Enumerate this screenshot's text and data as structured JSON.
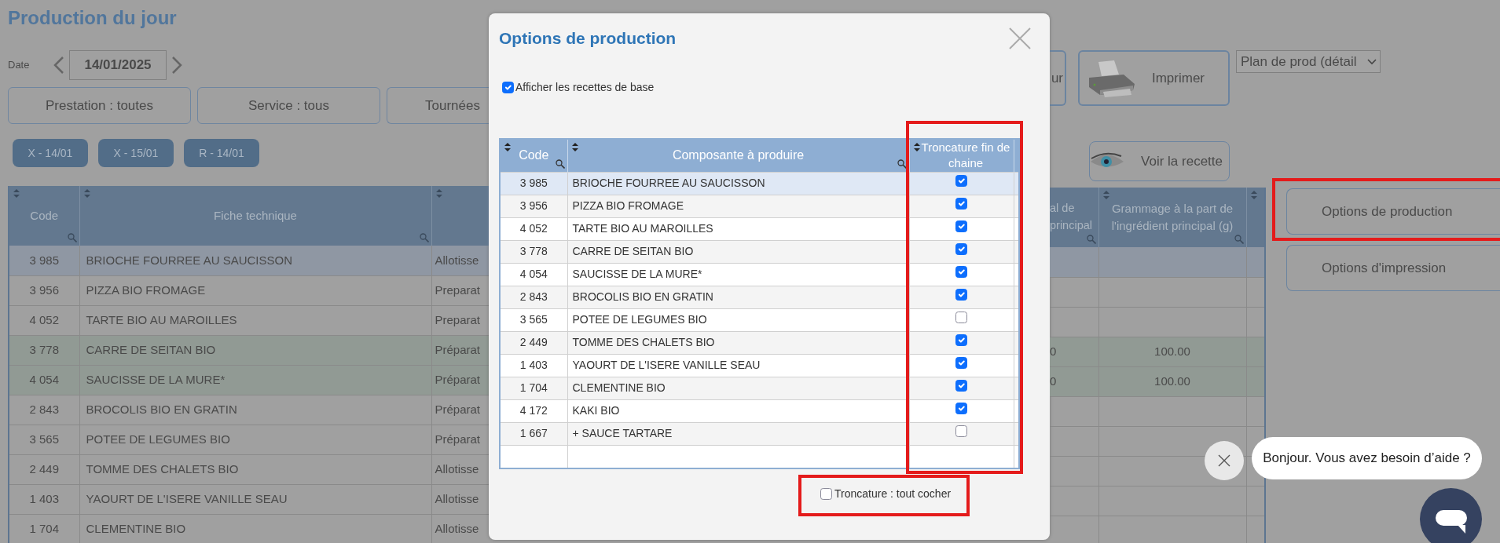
{
  "page": {
    "title": "Production du jour",
    "date_label": "Date",
    "date": "14/01/2025",
    "filters": [
      "Prestation : toutes",
      "Service : tous",
      "Tournées"
    ],
    "chips": [
      "X - 14/01",
      "X - 15/01",
      "R - 14/01"
    ],
    "partial_button": "ur",
    "print_button": "Imprimer",
    "report_select": "Plan de prod (détail",
    "view_recipe_button": "Voir la recette",
    "side_buttons": [
      {
        "label": "Options de production",
        "annotated": true
      },
      {
        "label": "Options d'impression",
        "annotated": false
      }
    ]
  },
  "main_table": {
    "columns": [
      "Code",
      "Fiche technique"
    ],
    "right_columns": [
      "al de principal",
      "Grammage à la part de l'ingrédient principal (g)"
    ],
    "rows": [
      {
        "code": "3 985",
        "name": "BRIOCHE FOURREE AU SAUCISSON",
        "column_3": "Allotisse",
        "selected": true,
        "highlighted": false
      },
      {
        "code": "3 956",
        "name": "PIZZA BIO FROMAGE",
        "column_3": "Preparat",
        "selected": false,
        "highlighted": false
      },
      {
        "code": "4 052",
        "name": "TARTE BIO AU MAROILLES",
        "column_3": "Preparat",
        "selected": false,
        "highlighted": false
      },
      {
        "code": "3 778",
        "name": "CARRE DE SEITAN BIO",
        "column_3": "Préparat",
        "principal": "0",
        "grammage": "100.00",
        "selected": false,
        "highlighted": true
      },
      {
        "code": "4 054",
        "name": "SAUCISSE DE LA MURE*",
        "column_3": "Préparat",
        "principal": "0",
        "grammage": "100.00",
        "selected": false,
        "highlighted": true
      },
      {
        "code": "2 843",
        "name": "BROCOLIS BIO EN GRATIN",
        "column_3": "Préparat",
        "selected": false,
        "highlighted": false
      },
      {
        "code": "3 565",
        "name": "POTEE DE LEGUMES BIO",
        "column_3": "Préparat",
        "selected": false,
        "highlighted": false
      },
      {
        "code": "2 449",
        "name": "TOMME DES CHALETS BIO",
        "column_3": "Allotisse",
        "selected": false,
        "highlighted": false
      },
      {
        "code": "1 403",
        "name": "YAOURT DE L'ISERE VANILLE SEAU",
        "column_3": "Allotisse",
        "selected": false,
        "highlighted": false
      },
      {
        "code": "1 704",
        "name": "CLEMENTINE BIO",
        "column_3": "Allotisse",
        "selected": false,
        "highlighted": false
      }
    ]
  },
  "dialog": {
    "title": "Options de production",
    "show_base_recipes": {
      "label": "Afficher les recettes de base",
      "checked": true
    },
    "columns": [
      {
        "label": "Code",
        "annotated": false
      },
      {
        "label": "Composante à produire",
        "annotated": false
      },
      {
        "label": "Troncature fin de chaine",
        "annotated": true
      }
    ],
    "rows": [
      {
        "code": "3 985",
        "name": "BRIOCHE FOURREE AU SAUCISSON",
        "truncate": true,
        "selected": true
      },
      {
        "code": "3 956",
        "name": "PIZZA BIO FROMAGE",
        "truncate": true,
        "selected": false
      },
      {
        "code": "4 052",
        "name": "TARTE BIO AU MAROILLES",
        "truncate": true,
        "selected": false
      },
      {
        "code": "3 778",
        "name": "CARRE DE SEITAN BIO",
        "truncate": true,
        "selected": false
      },
      {
        "code": "4 054",
        "name": "SAUCISSE DE LA MURE*",
        "truncate": true,
        "selected": false
      },
      {
        "code": "2 843",
        "name": "BROCOLIS BIO EN GRATIN",
        "truncate": true,
        "selected": false
      },
      {
        "code": "3 565",
        "name": "POTEE DE LEGUMES BIO",
        "truncate": false,
        "selected": false
      },
      {
        "code": "2 449",
        "name": "TOMME DES CHALETS BIO",
        "truncate": true,
        "selected": false
      },
      {
        "code": "1 403",
        "name": "YAOURT DE L'ISERE VANILLE SEAU",
        "truncate": true,
        "selected": false
      },
      {
        "code": "1 704",
        "name": "CLEMENTINE BIO",
        "truncate": true,
        "selected": false
      },
      {
        "code": "4 172",
        "name": "KAKI BIO",
        "truncate": true,
        "selected": false
      },
      {
        "code": "1 667",
        "name": "+ SAUCE TARTARE",
        "truncate": false,
        "selected": false
      }
    ],
    "check_all": {
      "label": "Troncature : tout cocher",
      "checked": false,
      "annotated": true
    }
  },
  "chat": {
    "message": "Bonjour. Vous avez besoin d’aide ?"
  }
}
